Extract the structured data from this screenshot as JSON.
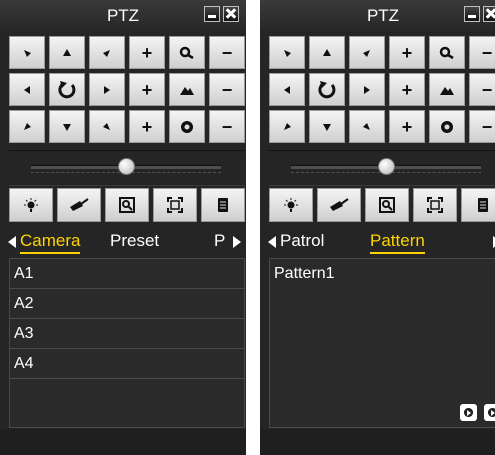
{
  "left_panel": {
    "title": "PTZ",
    "tabs": [
      "Camera",
      "Preset",
      "P"
    ],
    "active_tab": "Camera",
    "list_items": [
      "A1",
      "A2",
      "A3",
      "A4"
    ]
  },
  "right_panel": {
    "title": "PTZ",
    "tabs": [
      "Patrol",
      "Pattern"
    ],
    "active_tab": "Pattern",
    "list_items": [
      "Pattern1"
    ]
  },
  "ptz_buttons": [
    [
      "arrow-up-left-icon",
      "arrow-up-icon",
      "arrow-up-right-icon",
      "plus-icon",
      "zoom-icon",
      "minus-icon"
    ],
    [
      "arrow-left-icon",
      "auto-rotate-icon",
      "arrow-right-icon",
      "plus-icon",
      "focus-icon",
      "minus-icon"
    ],
    [
      "arrow-down-left-icon",
      "arrow-down-icon",
      "arrow-down-right-icon",
      "plus-icon",
      "iris-icon",
      "minus-icon"
    ]
  ],
  "tool_icons": [
    "light-icon",
    "wiper-icon",
    "3d-zoom-icon",
    "center-icon",
    "menu-icon"
  ],
  "speed_slider_level": 0.5,
  "colors": {
    "panel_bg": "#252525",
    "active_tab": "#ffd200",
    "text": "#ffffff"
  }
}
